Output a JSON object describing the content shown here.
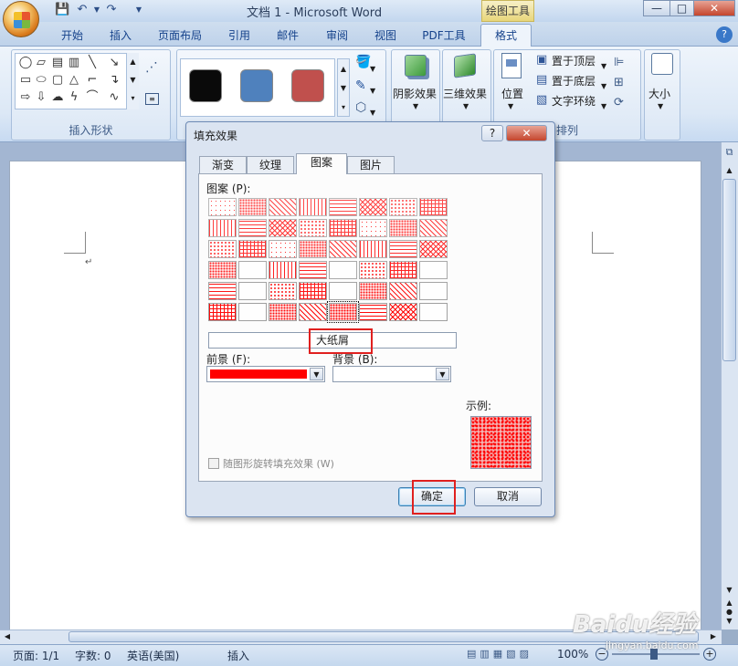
{
  "window": {
    "title": "文档 1 - Microsoft Word",
    "contextual_tab": "绘图工具",
    "controls": {
      "minimize": "—",
      "restore": "□",
      "close": "✕"
    }
  },
  "quick_access": {
    "save_icon": "save-icon",
    "undo_icon": "undo-icon",
    "redo_icon": "redo-icon",
    "customize_icon": "dropdown-icon"
  },
  "ribbon": {
    "tabs": [
      "开始",
      "插入",
      "页面布局",
      "引用",
      "邮件",
      "审阅",
      "视图",
      "PDF工具",
      "格式"
    ],
    "active_tab": "格式",
    "groups": {
      "insert_shapes": "插入形状",
      "arrange": "排列"
    },
    "style_swatches": [
      "#0a0a0a",
      "#4f81bd",
      "#c0504d"
    ],
    "shadow_effects": "阴影效果",
    "three_d_effects": "三维效果",
    "position": "位置",
    "bring_to_front": "置于顶层",
    "send_to_back": "置于底层",
    "text_wrap": "文字环绕",
    "size": "大小"
  },
  "dialog": {
    "title": "填充效果",
    "help": "?",
    "close": "✕",
    "tabs": [
      "渐变",
      "纹理",
      "图案",
      "图片"
    ],
    "active_tab": "图案",
    "pattern_label": "图案 (P):",
    "pattern_name": "大纸屑",
    "foreground_label": "前景 (F):",
    "foreground_color": "#ff0000",
    "background_label": "背景 (B):",
    "background_color": "#ffffff",
    "sample_label": "示例:",
    "rotate_label": "随图形旋转填充效果 (W)",
    "ok": "确定",
    "cancel": "取消",
    "pattern_rows": 6,
    "pattern_cols": 8,
    "selected_pattern_index": 44
  },
  "status": {
    "page": "页面: 1/1",
    "words": "字数: 0",
    "language": "英语(美国)",
    "mode": "插入",
    "zoom": "100%"
  },
  "watermark": {
    "text": "Baidu经验",
    "sub": "jingyan.baidu.com"
  }
}
